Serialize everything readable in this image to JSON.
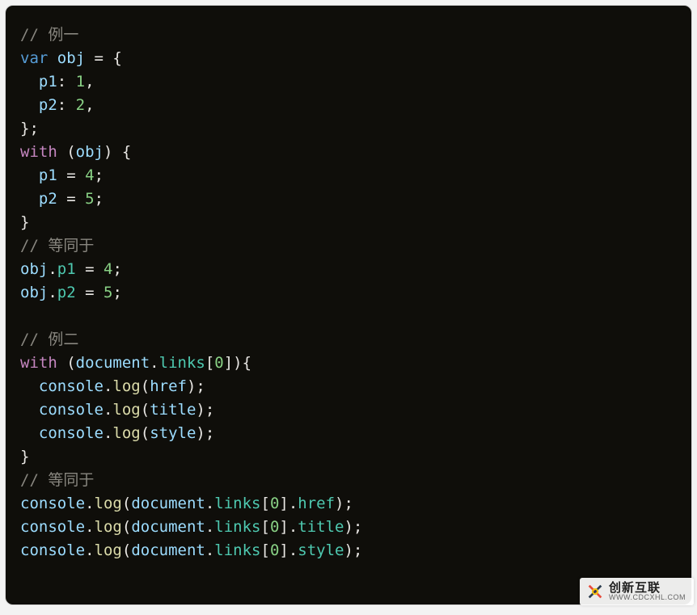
{
  "code": {
    "lines": [
      [
        {
          "t": "// 例一",
          "c": "c-cm"
        }
      ],
      [
        {
          "t": "var",
          "c": "c-kw"
        },
        {
          "t": " ",
          "c": "c-pn"
        },
        {
          "t": "obj",
          "c": "c-id"
        },
        {
          "t": " = {",
          "c": "c-pn"
        }
      ],
      [
        {
          "t": "  ",
          "c": "c-pn"
        },
        {
          "t": "p1",
          "c": "c-id"
        },
        {
          "t": ": ",
          "c": "c-pn"
        },
        {
          "t": "1",
          "c": "c-nm"
        },
        {
          "t": ",",
          "c": "c-pn"
        }
      ],
      [
        {
          "t": "  ",
          "c": "c-pn"
        },
        {
          "t": "p2",
          "c": "c-id"
        },
        {
          "t": ": ",
          "c": "c-pn"
        },
        {
          "t": "2",
          "c": "c-nm"
        },
        {
          "t": ",",
          "c": "c-pn"
        }
      ],
      [
        {
          "t": "};",
          "c": "c-pn"
        }
      ],
      [
        {
          "t": "with",
          "c": "c-wth"
        },
        {
          "t": " (",
          "c": "c-pn"
        },
        {
          "t": "obj",
          "c": "c-id"
        },
        {
          "t": ") {",
          "c": "c-pn"
        }
      ],
      [
        {
          "t": "  ",
          "c": "c-pn"
        },
        {
          "t": "p1",
          "c": "c-id"
        },
        {
          "t": " = ",
          "c": "c-pn"
        },
        {
          "t": "4",
          "c": "c-nm"
        },
        {
          "t": ";",
          "c": "c-pn"
        }
      ],
      [
        {
          "t": "  ",
          "c": "c-pn"
        },
        {
          "t": "p2",
          "c": "c-id"
        },
        {
          "t": " = ",
          "c": "c-pn"
        },
        {
          "t": "5",
          "c": "c-nm"
        },
        {
          "t": ";",
          "c": "c-pn"
        }
      ],
      [
        {
          "t": "}",
          "c": "c-pn"
        }
      ],
      [
        {
          "t": "// 等同于",
          "c": "c-cm"
        }
      ],
      [
        {
          "t": "obj",
          "c": "c-id"
        },
        {
          "t": ".",
          "c": "c-pn"
        },
        {
          "t": "p1",
          "c": "c-mb"
        },
        {
          "t": " = ",
          "c": "c-pn"
        },
        {
          "t": "4",
          "c": "c-nm"
        },
        {
          "t": ";",
          "c": "c-pn"
        }
      ],
      [
        {
          "t": "obj",
          "c": "c-id"
        },
        {
          "t": ".",
          "c": "c-pn"
        },
        {
          "t": "p2",
          "c": "c-mb"
        },
        {
          "t": " = ",
          "c": "c-pn"
        },
        {
          "t": "5",
          "c": "c-nm"
        },
        {
          "t": ";",
          "c": "c-pn"
        }
      ],
      [
        {
          "t": " ",
          "c": "c-pn"
        }
      ],
      [
        {
          "t": "// 例二",
          "c": "c-cm"
        }
      ],
      [
        {
          "t": "with",
          "c": "c-wth"
        },
        {
          "t": " (",
          "c": "c-pn"
        },
        {
          "t": "document",
          "c": "c-id"
        },
        {
          "t": ".",
          "c": "c-pn"
        },
        {
          "t": "links",
          "c": "c-mb"
        },
        {
          "t": "[",
          "c": "c-pn"
        },
        {
          "t": "0",
          "c": "c-nm"
        },
        {
          "t": "]){",
          "c": "c-pn"
        }
      ],
      [
        {
          "t": "  ",
          "c": "c-pn"
        },
        {
          "t": "console",
          "c": "c-id"
        },
        {
          "t": ".",
          "c": "c-pn"
        },
        {
          "t": "log",
          "c": "c-fn"
        },
        {
          "t": "(",
          "c": "c-pn"
        },
        {
          "t": "href",
          "c": "c-id"
        },
        {
          "t": ");",
          "c": "c-pn"
        }
      ],
      [
        {
          "t": "  ",
          "c": "c-pn"
        },
        {
          "t": "console",
          "c": "c-id"
        },
        {
          "t": ".",
          "c": "c-pn"
        },
        {
          "t": "log",
          "c": "c-fn"
        },
        {
          "t": "(",
          "c": "c-pn"
        },
        {
          "t": "title",
          "c": "c-id"
        },
        {
          "t": ");",
          "c": "c-pn"
        }
      ],
      [
        {
          "t": "  ",
          "c": "c-pn"
        },
        {
          "t": "console",
          "c": "c-id"
        },
        {
          "t": ".",
          "c": "c-pn"
        },
        {
          "t": "log",
          "c": "c-fn"
        },
        {
          "t": "(",
          "c": "c-pn"
        },
        {
          "t": "style",
          "c": "c-id"
        },
        {
          "t": ");",
          "c": "c-pn"
        }
      ],
      [
        {
          "t": "}",
          "c": "c-pn"
        }
      ],
      [
        {
          "t": "// 等同于",
          "c": "c-cm"
        }
      ],
      [
        {
          "t": "console",
          "c": "c-id"
        },
        {
          "t": ".",
          "c": "c-pn"
        },
        {
          "t": "log",
          "c": "c-fn"
        },
        {
          "t": "(",
          "c": "c-pn"
        },
        {
          "t": "document",
          "c": "c-id"
        },
        {
          "t": ".",
          "c": "c-pn"
        },
        {
          "t": "links",
          "c": "c-mb"
        },
        {
          "t": "[",
          "c": "c-pn"
        },
        {
          "t": "0",
          "c": "c-nm"
        },
        {
          "t": "].",
          "c": "c-pn"
        },
        {
          "t": "href",
          "c": "c-mb"
        },
        {
          "t": ");",
          "c": "c-pn"
        }
      ],
      [
        {
          "t": "console",
          "c": "c-id"
        },
        {
          "t": ".",
          "c": "c-pn"
        },
        {
          "t": "log",
          "c": "c-fn"
        },
        {
          "t": "(",
          "c": "c-pn"
        },
        {
          "t": "document",
          "c": "c-id"
        },
        {
          "t": ".",
          "c": "c-pn"
        },
        {
          "t": "links",
          "c": "c-mb"
        },
        {
          "t": "[",
          "c": "c-pn"
        },
        {
          "t": "0",
          "c": "c-nm"
        },
        {
          "t": "].",
          "c": "c-pn"
        },
        {
          "t": "title",
          "c": "c-mb"
        },
        {
          "t": ");",
          "c": "c-pn"
        }
      ],
      [
        {
          "t": "console",
          "c": "c-id"
        },
        {
          "t": ".",
          "c": "c-pn"
        },
        {
          "t": "log",
          "c": "c-fn"
        },
        {
          "t": "(",
          "c": "c-pn"
        },
        {
          "t": "document",
          "c": "c-id"
        },
        {
          "t": ".",
          "c": "c-pn"
        },
        {
          "t": "links",
          "c": "c-mb"
        },
        {
          "t": "[",
          "c": "c-pn"
        },
        {
          "t": "0",
          "c": "c-nm"
        },
        {
          "t": "].",
          "c": "c-pn"
        },
        {
          "t": "style",
          "c": "c-mb"
        },
        {
          "t": ");",
          "c": "c-pn"
        }
      ]
    ]
  },
  "watermark": {
    "brand_cn": "创新互联",
    "brand_en": "WWW.CDCXHL.COM"
  }
}
